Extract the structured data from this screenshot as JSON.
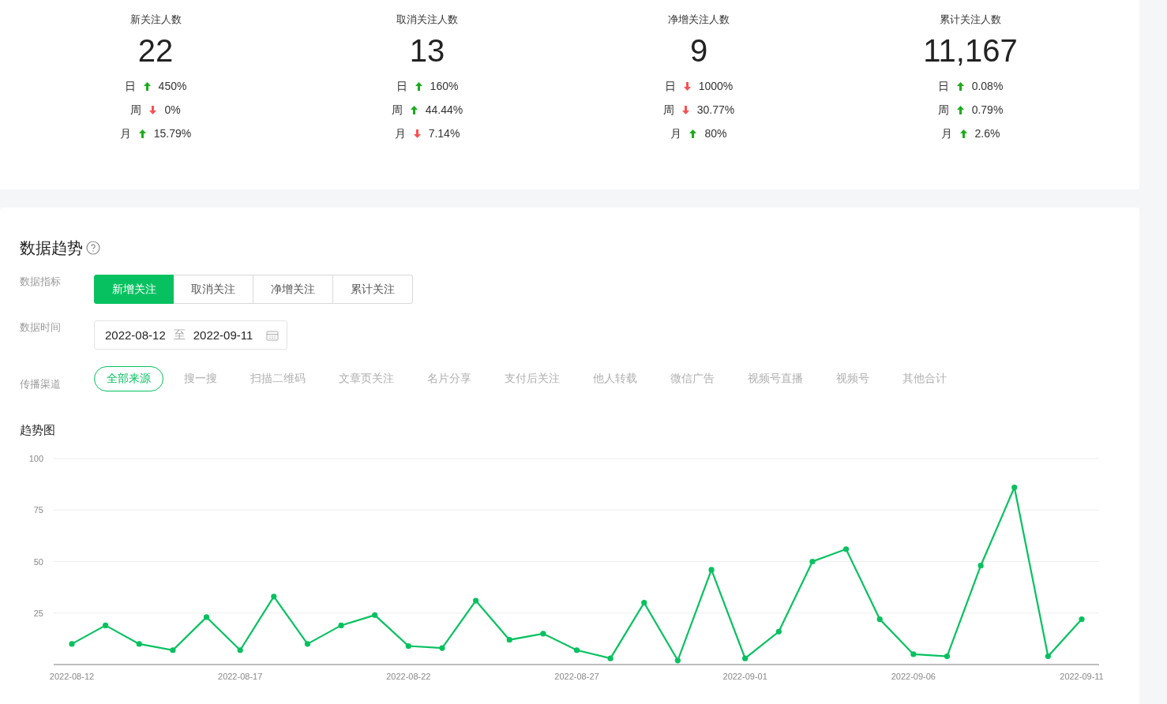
{
  "stats": [
    {
      "title": "新关注人数",
      "value": "22",
      "changes": [
        {
          "period": "日",
          "kind": "up",
          "percent": "450%"
        },
        {
          "period": "周",
          "kind": "down",
          "percent": "0%"
        },
        {
          "period": "月",
          "kind": "up",
          "percent": "15.79%"
        }
      ]
    },
    {
      "title": "取消关注人数",
      "value": "13",
      "changes": [
        {
          "period": "日",
          "kind": "up",
          "percent": "160%"
        },
        {
          "period": "周",
          "kind": "up",
          "percent": "44.44%"
        },
        {
          "period": "月",
          "kind": "down",
          "percent": "7.14%"
        }
      ]
    },
    {
      "title": "净增关注人数",
      "value": "9",
      "changes": [
        {
          "period": "日",
          "kind": "down",
          "percent": "1000%"
        },
        {
          "period": "周",
          "kind": "down",
          "percent": "30.77%"
        },
        {
          "period": "月",
          "kind": "up",
          "percent": "80%"
        }
      ]
    },
    {
      "title": "累计关注人数",
      "value": "11,167",
      "changes": [
        {
          "period": "日",
          "kind": "up",
          "percent": "0.08%"
        },
        {
          "period": "周",
          "kind": "up",
          "percent": "0.79%"
        },
        {
          "period": "月",
          "kind": "up",
          "percent": "2.6%"
        }
      ]
    }
  ],
  "trend": {
    "title": "数据趋势",
    "metric": {
      "label": "数据指标",
      "options": [
        {
          "label": "新增关注",
          "selected": true
        },
        {
          "label": "取消关注",
          "selected": false
        },
        {
          "label": "净增关注",
          "selected": false
        },
        {
          "label": "累计关注",
          "selected": false
        }
      ]
    },
    "date_range": {
      "label": "数据时间",
      "start": "2022-08-12",
      "separator": "至",
      "end": "2022-09-11"
    },
    "channel": {
      "label": "传播渠道",
      "options": [
        {
          "label": "全部来源",
          "selected": true
        },
        {
          "label": "搜一搜",
          "selected": false
        },
        {
          "label": "扫描二维码",
          "selected": false
        },
        {
          "label": "文章页关注",
          "selected": false
        },
        {
          "label": "名片分享",
          "selected": false
        },
        {
          "label": "支付后关注",
          "selected": false
        },
        {
          "label": "他人转载",
          "selected": false
        },
        {
          "label": "微信广告",
          "selected": false
        },
        {
          "label": "视频号直播",
          "selected": false
        },
        {
          "label": "视频号",
          "selected": false
        },
        {
          "label": "其他合计",
          "selected": false
        }
      ]
    },
    "chart_title": "趋势图",
    "chart_data": {
      "type": "line",
      "grid": true,
      "categories": [
        "2022-08-12",
        null,
        null,
        null,
        null,
        "2022-08-17",
        null,
        null,
        null,
        null,
        "2022-08-22",
        null,
        null,
        null,
        null,
        "2022-08-27",
        null,
        null,
        null,
        null,
        "2022-09-01",
        null,
        null,
        null,
        null,
        "2022-09-06",
        null,
        null,
        null,
        null,
        "2022-09-11"
      ],
      "series": [
        {
          "color": "#07c160",
          "marker": "circle",
          "values": [
            10,
            19,
            10,
            7,
            23,
            7,
            33,
            10,
            19,
            24,
            9,
            8,
            31,
            12,
            15,
            7,
            3,
            30,
            2,
            46,
            3,
            16,
            50,
            56,
            22,
            5,
            4,
            48,
            86,
            4,
            22
          ]
        }
      ],
      "ylim": [
        0,
        100
      ],
      "yticks": [
        25,
        50,
        75,
        100
      ]
    }
  }
}
